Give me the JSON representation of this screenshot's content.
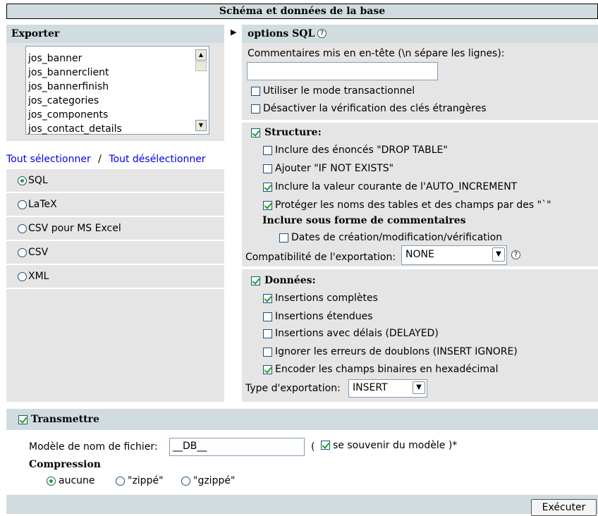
{
  "title": "Schéma et données de la base",
  "export": {
    "header": "Exporter",
    "tables": [
      "jos_banner",
      "jos_bannerclient",
      "jos_bannerfinish",
      "jos_categories",
      "jos_components",
      "jos_contact_details"
    ],
    "select_all": "Tout sélectionner",
    "separator": "/",
    "deselect_all": "Tout désélectionner",
    "formats": [
      {
        "label": "SQL",
        "checked": true
      },
      {
        "label": "LaTeX",
        "checked": false
      },
      {
        "label": "CSV pour MS Excel",
        "checked": false
      },
      {
        "label": "CSV",
        "checked": false
      },
      {
        "label": "XML",
        "checked": false
      }
    ]
  },
  "options": {
    "header": "options SQL",
    "comments_label": "Commentaires mis en en-tête (\\n sépare les lignes):",
    "comments_value": "",
    "transactional": "Utiliser le mode transactionnel",
    "disable_fk": "Désactiver la vérification des clés étrangères",
    "structure": {
      "label": "Structure:",
      "drop_table": "Inclure des énoncés \"DROP TABLE\"",
      "if_not_exists": "Ajouter \"IF NOT EXISTS\"",
      "auto_increment": "Inclure la valeur courante de l'AUTO_INCREMENT",
      "protect_names": "Protéger les noms des tables et des champs par des \"`\"",
      "as_comments": "Inclure sous forme de commentaires",
      "dates": "Dates de création/modification/vérification",
      "compat_label": "Compatibilité de l'exportation:",
      "compat_value": "NONE"
    },
    "data": {
      "label": "Données:",
      "complete_inserts": "Insertions complètes",
      "extended_inserts": "Insertions étendues",
      "delayed_inserts": "Insertions avec délais (DELAYED)",
      "ignore_dupes": "Ignorer les erreurs de doublons (INSERT IGNORE)",
      "hex_binary": "Encoder les champs binaires en hexadécimal",
      "export_type_label": "Type d'exportation:",
      "export_type_value": "INSERT"
    }
  },
  "transmit": {
    "label": "Transmettre",
    "filename_label": "Modèle de nom de fichier:",
    "filename_value": "__DB__",
    "open_paren": "(",
    "remember_label": "se souvenir du modèle )*",
    "compression_label": "Compression",
    "compression_options": [
      "aucune",
      "\"zippé\"",
      "\"gzippé\""
    ]
  },
  "execute_label": "Exécuter",
  "icons": {
    "help": "help-icon",
    "arrow": "triangle-right-icon",
    "dropdown": "chevron-down-icon"
  }
}
